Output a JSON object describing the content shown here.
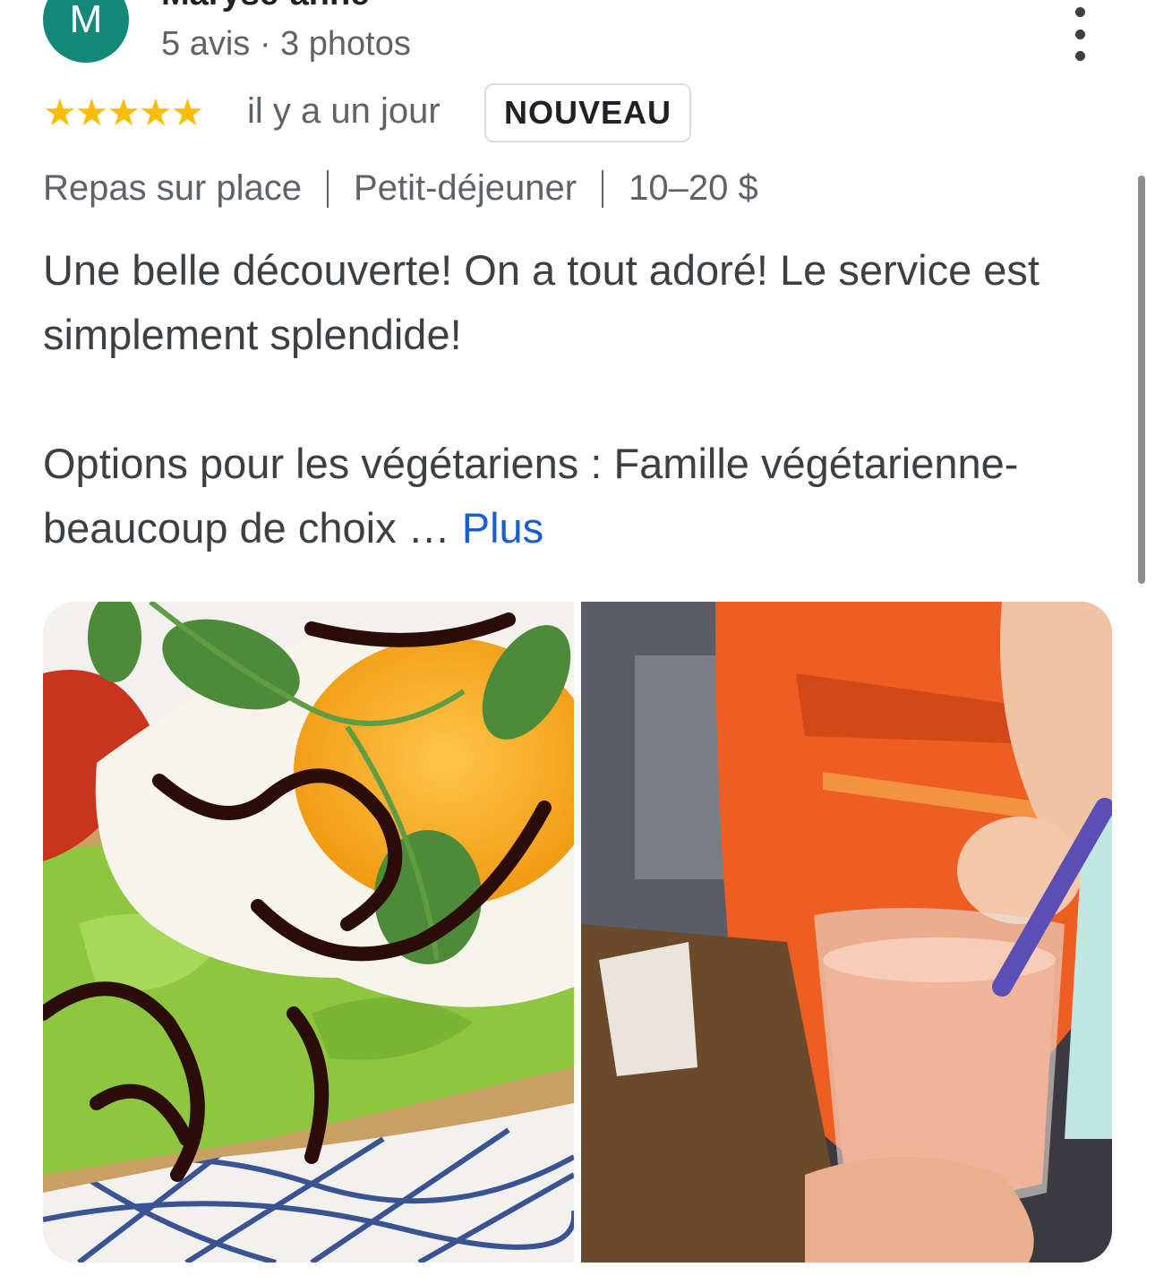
{
  "author": {
    "initial": "M",
    "name": "Maryse-anne",
    "meta": "5 avis · 3 photos"
  },
  "rating": {
    "stars": "★★★★★",
    "value": 5,
    "max": 5,
    "date": "il y a un jour",
    "badge": "NOUVEAU"
  },
  "attributes": {
    "service": "Repas sur place",
    "meal": "Petit-déjeuner",
    "price": "10–20 $"
  },
  "review": {
    "paragraph1": "Une belle découverte! On a tout adoré! Le service est simplement splendide!",
    "paragraph2": "Options pour les végétariens : Famille végétarienne- beaucoup de choix …",
    "more_label": "Plus"
  },
  "colors": {
    "avatar": "#14897a",
    "stars": "#fbbc04",
    "link": "#1a5fd0"
  },
  "icons": {
    "more": "more-vert-icon",
    "star": "star-icon"
  }
}
